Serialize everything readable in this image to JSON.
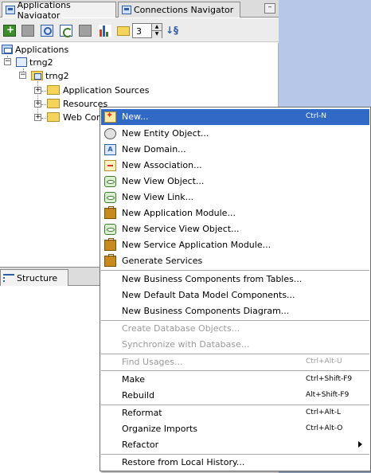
{
  "tabs": [
    {
      "label": "Applications Navigator",
      "active": true
    },
    {
      "label": "Connections Navigator",
      "active": false
    }
  ],
  "tab_close_glyph": "–",
  "toolbar": {
    "level_value": "3",
    "icons": [
      "add-icon",
      "delete-icon",
      "find-icon",
      "sync-icon",
      "properties-icon",
      "chart-icon",
      "folder-icon",
      "sort-icon"
    ]
  },
  "tree": {
    "root": "Applications",
    "app": "trng2",
    "project": "trng2",
    "folders": [
      "Application Sources",
      "Resources",
      "Web Con"
    ]
  },
  "structure_tab": "Structure",
  "menu": {
    "items": [
      {
        "label": "New...",
        "shortcut": "Ctrl-N",
        "icon": "new-icon",
        "selected": true
      },
      {
        "label": "New Entity Object...",
        "shortcut": "",
        "icon": "entity-object-icon"
      },
      {
        "label": "New Domain...",
        "shortcut": "",
        "icon": "domain-icon"
      },
      {
        "label": "New Association...",
        "shortcut": "",
        "icon": "association-icon"
      },
      {
        "label": "New View Object...",
        "shortcut": "",
        "icon": "view-object-icon"
      },
      {
        "label": "New View Link...",
        "shortcut": "",
        "icon": "view-link-icon"
      },
      {
        "label": "New Application Module...",
        "shortcut": "",
        "icon": "application-module-icon"
      },
      {
        "label": "New Service View Object...",
        "shortcut": "",
        "icon": "service-view-object-icon"
      },
      {
        "label": "New Service Application Module...",
        "shortcut": "",
        "icon": "service-application-module-icon"
      },
      {
        "label": "Generate Services",
        "shortcut": "",
        "icon": "generate-services-icon"
      },
      {
        "label": "New Business Components from Tables...",
        "shortcut": ""
      },
      {
        "label": "New Default Data Model Components...",
        "shortcut": ""
      },
      {
        "label": "New Business Components Diagram...",
        "shortcut": ""
      },
      {
        "label": "Create Database Objects...",
        "shortcut": "",
        "disabled": true
      },
      {
        "label": "Synchronize with Database...",
        "shortcut": "",
        "disabled": true
      },
      {
        "label": "Find Usages...",
        "shortcut": "Ctrl+Alt-U",
        "disabled": true
      },
      {
        "label": "Make",
        "shortcut": "Ctrl+Shift-F9"
      },
      {
        "label": "Rebuild",
        "shortcut": "Alt+Shift-F9"
      },
      {
        "label": "Reformat",
        "shortcut": "Ctrl+Alt-L"
      },
      {
        "label": "Organize Imports",
        "shortcut": "Ctrl+Alt-O"
      },
      {
        "label": "Refactor",
        "shortcut": "",
        "submenu": true
      },
      {
        "label": "Restore from Local History...",
        "shortcut": ""
      }
    ]
  }
}
